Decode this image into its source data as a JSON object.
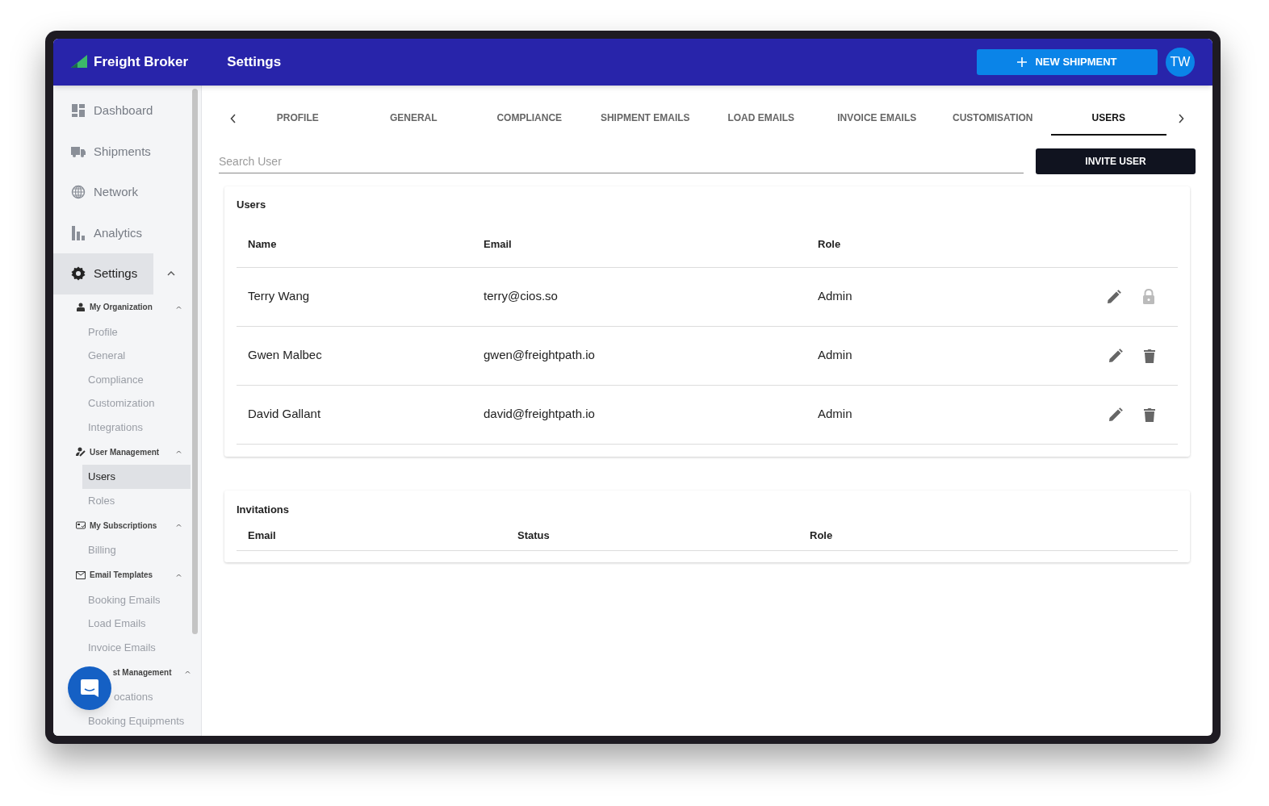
{
  "app": {
    "name": "Freight Broker",
    "page_title": "Settings",
    "new_button": "NEW SHIPMENT",
    "avatar": "TW"
  },
  "sidebar": {
    "nav": [
      {
        "label": "Dashboard",
        "selected": false
      },
      {
        "label": "Shipments",
        "selected": false
      },
      {
        "label": "Network",
        "selected": false
      },
      {
        "label": "Analytics",
        "selected": false
      },
      {
        "label": "Settings",
        "selected": true,
        "expanded": true
      }
    ],
    "groups": [
      {
        "title": "My Organization",
        "expanded": true,
        "items": [
          {
            "label": "Profile",
            "selected": false
          },
          {
            "label": "General",
            "selected": false
          },
          {
            "label": "Compliance",
            "selected": false
          },
          {
            "label": "Customization",
            "selected": false
          },
          {
            "label": "Integrations",
            "selected": false
          }
        ]
      },
      {
        "title": "User Management",
        "expanded": true,
        "items": [
          {
            "label": "Users",
            "selected": true
          },
          {
            "label": "Roles",
            "selected": false
          }
        ]
      },
      {
        "title": "My Subscriptions",
        "expanded": true,
        "items": [
          {
            "label": "Billing",
            "selected": false
          }
        ]
      },
      {
        "title": "Email Templates",
        "expanded": true,
        "items": [
          {
            "label": "Booking Emails",
            "selected": false
          },
          {
            "label": "Load Emails",
            "selected": false
          },
          {
            "label": "Invoice Emails",
            "selected": false
          }
        ]
      },
      {
        "title": "st Management",
        "expanded": true,
        "items": [
          {
            "label": "ocations",
            "selected": false
          },
          {
            "label": "Booking Equipments",
            "selected": false
          }
        ]
      }
    ]
  },
  "tabs": [
    {
      "label": "PROFILE",
      "selected": false
    },
    {
      "label": "GENERAL",
      "selected": false
    },
    {
      "label": "COMPLIANCE",
      "selected": false
    },
    {
      "label": "SHIPMENT EMAILS",
      "selected": false
    },
    {
      "label": "LOAD EMAILS",
      "selected": false
    },
    {
      "label": "INVOICE EMAILS",
      "selected": false
    },
    {
      "label": "CUSTOMISATION",
      "selected": false
    },
    {
      "label": "USERS",
      "selected": true
    }
  ],
  "search": {
    "placeholder": "Search User"
  },
  "invite_button": "INVITE USER",
  "users": {
    "title": "Users",
    "columns": [
      "Name",
      "Email",
      "Role"
    ],
    "rows": [
      {
        "name": "Terry Wang",
        "email": "terry@cios.so",
        "role": "Admin",
        "locked": true
      },
      {
        "name": "Gwen Malbec",
        "email": "gwen@freightpath.io",
        "role": "Admin",
        "locked": false
      },
      {
        "name": "David Gallant",
        "email": "david@freightpath.io",
        "role": "Admin",
        "locked": false
      }
    ]
  },
  "invitations": {
    "title": "Invitations",
    "columns": [
      "Email",
      "Status",
      "Role"
    ]
  }
}
